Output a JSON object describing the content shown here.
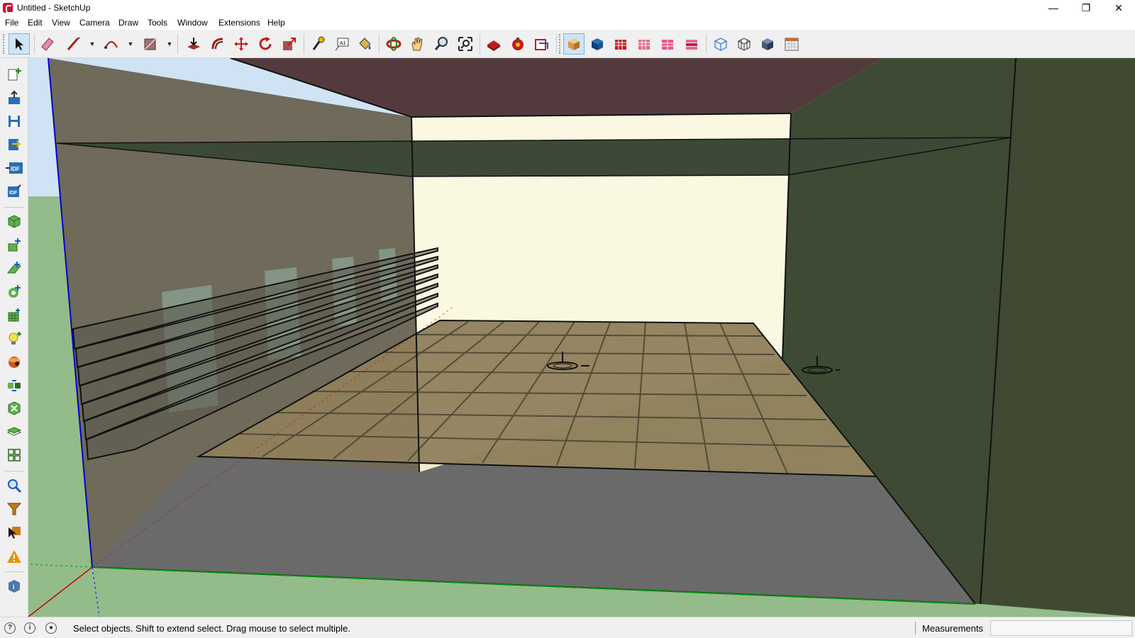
{
  "window": {
    "title": "Untitled - SketchUp",
    "controls": {
      "minimize": "—",
      "restore": "❐",
      "close": "✕"
    }
  },
  "menu": [
    "File",
    "Edit",
    "View",
    "Camera",
    "Draw",
    "Tools",
    "Window",
    "Extensions",
    "Help"
  ],
  "toolbar": {
    "main_tools": [
      "select-tool-icon",
      "eraser-tool-icon",
      "line-tool-icon",
      "arc-tool-icon",
      "rectangle-tool-icon",
      "push-pull-tool-icon",
      "offset-tool-icon",
      "move-tool-icon",
      "rotate-tool-icon",
      "scale-tool-icon",
      "tape-measure-tool-icon",
      "text-tool-icon",
      "paint-bucket-tool-icon",
      "orbit-tool-icon",
      "pan-tool-icon",
      "zoom-tool-icon",
      "zoom-extents-icon",
      "3d-warehouse-icon",
      "extension-warehouse-icon",
      "layout-icon"
    ],
    "view_tools": [
      "iso-view-icon",
      "top-view-icon",
      "front-view-icon",
      "right-view-icon",
      "back-view-icon",
      "left-view-icon",
      "xray-style-icon",
      "wireframe-style-icon",
      "shaded-style-icon",
      "calendar-icon"
    ],
    "active_tool": "select-tool-icon",
    "active_view": "iso-view-icon"
  },
  "left_toolbar": [
    "new-object-icon",
    "import-icon",
    "save-icon",
    "export-icon",
    "idf-import-icon",
    "idf-export-icon",
    "space-icon",
    "shading-surface-icon",
    "interior-partition-icon",
    "daylighting-icon",
    "illuminance-map-icon",
    "luminaire-icon",
    "glare-sensor-icon",
    "surface-matching-icon",
    "apply-settings-icon",
    "layer-icon",
    "component-grid-icon",
    "search-icon",
    "filter-icon",
    "select-cursor-icon",
    "warning-icon",
    "info-icon"
  ],
  "status": {
    "icons": [
      "geo-location-icon",
      "credits-icon",
      "user-icon"
    ],
    "message": "Select objects. Shift to extend select. Drag mouse to select multiple.",
    "measurements_label": "Measurements",
    "measurements_value": ""
  },
  "colors": {
    "ground": "#93bc8a",
    "sky": "#cfe3f5",
    "ceiling": "#533b3d",
    "left_wall": "#6f6a5a",
    "right_wall": "#3e4a33",
    "back_wall": "#fbf8e1",
    "floor_slab": "#6a6a6a",
    "floor_grid": "#8f7f5c",
    "light_shelf": "#3c4936",
    "window_glass": "#86998a",
    "axis_red": "#cc0000",
    "axis_green": "#009900",
    "axis_blue": "#0000ff",
    "active_button": "#cde6f7"
  }
}
